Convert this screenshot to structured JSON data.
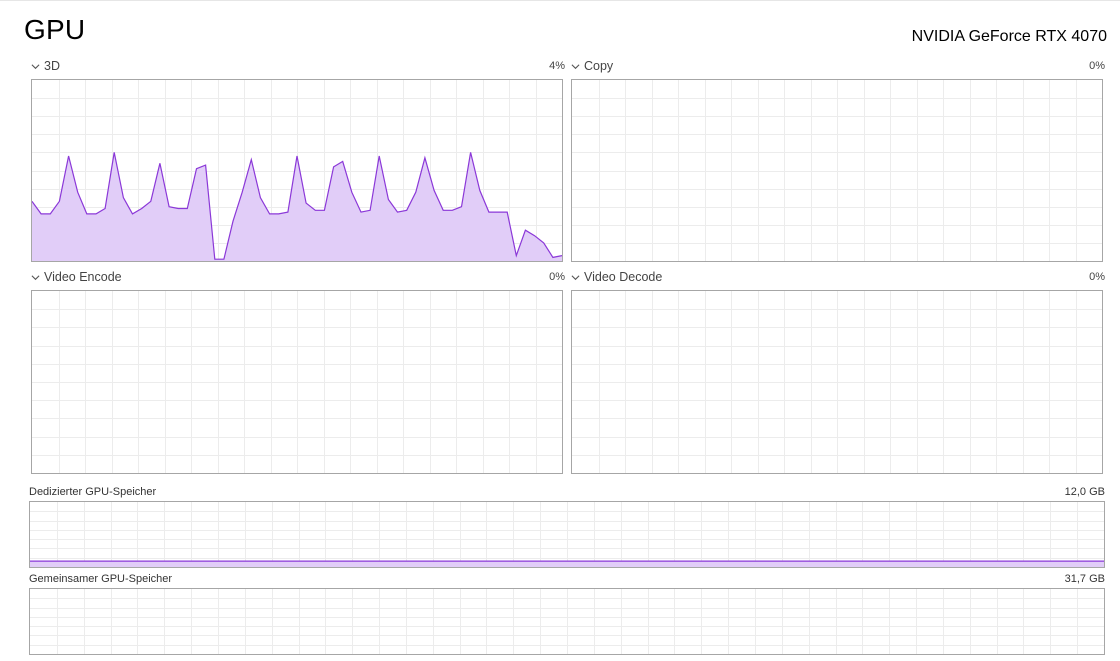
{
  "page": {
    "title": "GPU",
    "device_name": "NVIDIA GeForce RTX 4070"
  },
  "colors": {
    "graph_line": "#8b38d8",
    "graph_fill": "#e1cdf8",
    "grid": "#ececec",
    "border": "#a6a6a6"
  },
  "engines": [
    {
      "label": "3D",
      "percent": "4%",
      "icon": "chevron-down-icon",
      "series": [
        33,
        26,
        26,
        33,
        58,
        38,
        26,
        26,
        29,
        60,
        35,
        26,
        29,
        33,
        54,
        30,
        29,
        29,
        51,
        53,
        1,
        1,
        22,
        38,
        56,
        35,
        26,
        26,
        27,
        58,
        32,
        28,
        28,
        52,
        55,
        38,
        27,
        28,
        58,
        34,
        27,
        28,
        38,
        57,
        39,
        28,
        28,
        30,
        60,
        39,
        27,
        27,
        27,
        3,
        17,
        14,
        10,
        2,
        3
      ]
    },
    {
      "label": "Copy",
      "percent": "0%",
      "icon": "chevron-down-icon",
      "series": []
    },
    {
      "label": "Video Encode",
      "percent": "0%",
      "icon": "chevron-down-icon",
      "series": []
    },
    {
      "label": "Video Decode",
      "percent": "0%",
      "icon": "chevron-down-icon",
      "series": []
    }
  ],
  "memory": [
    {
      "label": "Dedizierter GPU-Speicher",
      "max": "12,0 GB",
      "used_fraction": 0.09
    },
    {
      "label": "Gemeinsamer GPU-Speicher",
      "max": "31,7 GB",
      "used_fraction": 0.0
    }
  ]
}
